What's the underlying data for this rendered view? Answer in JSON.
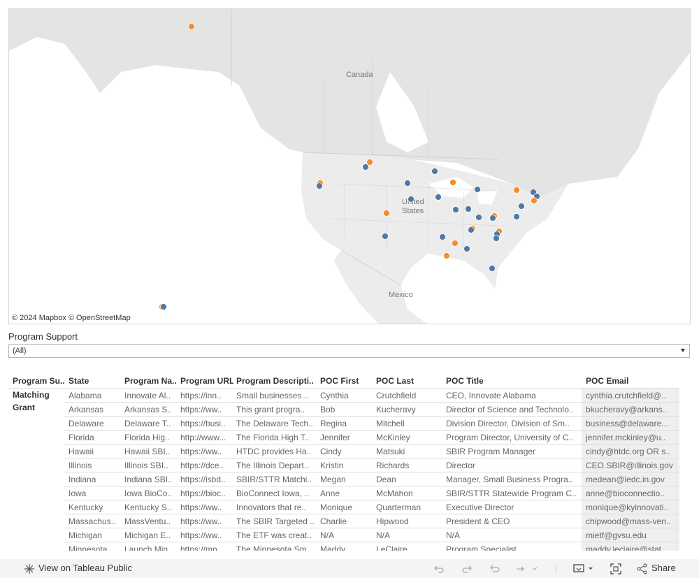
{
  "map": {
    "labels": {
      "canada": "Canada",
      "united_states": "United\nStates",
      "mexico": "Mexico"
    },
    "attribution": "© 2024 Mapbox  © OpenStreetMap",
    "colors": {
      "blue": "#4e79a7",
      "orange": "#f28e2b",
      "land": "#e6e6e6",
      "water": "#ffffff"
    }
  },
  "filter": {
    "label": "Program Support",
    "selected": "(All)"
  },
  "table": {
    "headers": [
      "Program Su..",
      "State",
      "Program Na..",
      "Program URL",
      "Program Descripti..",
      "POC First",
      "POC Last",
      "POC Title",
      "POC Email"
    ],
    "group_label": "Matching Grant",
    "rows": [
      [
        "Alabama",
        "Innovate Al..",
        "https://inn..",
        "Small businesses ..",
        "Cynthia",
        "Crutchfield",
        "CEO, Innovate Alabama",
        "cynthia.crutchfield@.."
      ],
      [
        "Arkansas",
        "Arkansas S..",
        "https://ww..",
        "This grant progra..",
        "Bob",
        "Kucheravy",
        "Director of Science and Technolo..",
        "bkucheravy@arkans.."
      ],
      [
        "Delaware",
        "Delaware T..",
        "https://busi..",
        "The Delaware Tech..",
        "Regina",
        "Mitchell",
        "Division Director, Division of Sm..",
        "business@delaware..."
      ],
      [
        "Florida",
        "Florida Hig..",
        "http://www...",
        "The Florida High T..",
        "Jennifer",
        "McKinley",
        "Program Director, University of C..",
        "jennifer.mckinley@u.."
      ],
      [
        "Hawaii",
        "Hawaii SBI..",
        "https://ww..",
        "HTDC provides Ha..",
        "Cindy",
        "Matsuki",
        "SBIR Program Manager",
        "cindy@htdc.org OR s.."
      ],
      [
        "Illinois",
        "Illinois SBI..",
        "https://dce..",
        "The Illinois Depart..",
        "Kristin",
        "Richards",
        "Director",
        "CEO.SBIR@illinois.gov"
      ],
      [
        "Indiana",
        "Indiana SBI..",
        "https://isbd..",
        "SBIR/STTR Matchi..",
        "Megan",
        "Dean",
        "Manager, Small Business Progra..",
        "medean@iedc.in.gov"
      ],
      [
        "Iowa",
        "Iowa BioCo..",
        "https://bioc..",
        "BioConnect Iowa, ..",
        "Anne",
        "McMahon",
        "SBIR/STTR Statewide Program C..",
        "anne@bioconnectio.."
      ],
      [
        "Kentucky",
        "Kentucky S..",
        "https://ww..",
        "Innovators that re..",
        "Monique",
        "Quarterman",
        "Executive Director",
        "monique@kyinnovati.."
      ],
      [
        "Massachus..",
        "MassVentu..",
        "https://ww..",
        "The SBIR Targeted ..",
        "Charlie",
        "Hipwood",
        "President & CEO",
        "chipwood@mass-ven.."
      ],
      [
        "Michigan",
        "Michigan E..",
        "https://ww..",
        "The ETF was creat..",
        "N/A",
        "N/A",
        "N/A",
        "mietf@gvsu.edu"
      ],
      [
        "Minnesota",
        "Launch Min..",
        "https://mn..",
        "The Minnesota Sm..",
        "Maddy",
        "LeClaire",
        "Program Specialist",
        "maddy.leclaire@stat.."
      ]
    ]
  },
  "toolbar": {
    "view_label": "View on Tableau Public",
    "share_label": "Share",
    "icons": [
      "tableau-logo-icon",
      "undo-icon",
      "redo-icon",
      "revert-icon",
      "refresh-icon",
      "download-icon",
      "fullscreen-icon",
      "share-icon"
    ]
  }
}
